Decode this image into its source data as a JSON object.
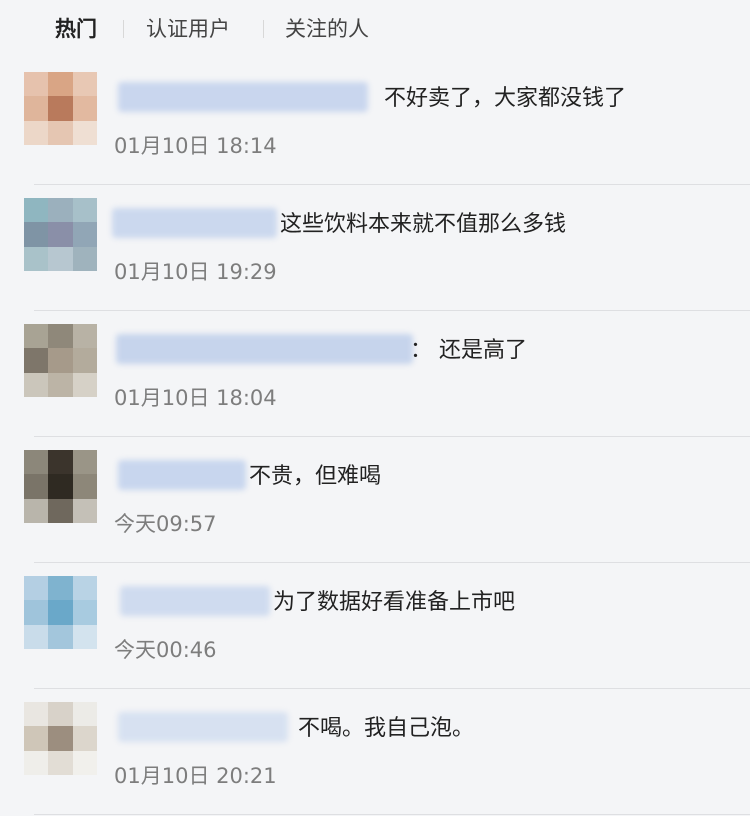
{
  "tabs": [
    {
      "label": "热门",
      "active": true
    },
    {
      "label": "认证用户",
      "active": false
    },
    {
      "label": "关注的人",
      "active": false
    }
  ],
  "comments": [
    {
      "text": "不好卖了，大家都没钱了",
      "time": "01月10日 18:14",
      "avatar_colors": [
        "#e6c2ad",
        "#d9a585",
        "#e8c8b4",
        "#dfb59b",
        "#b97a5c",
        "#e2b9a0",
        "#ecd7c8",
        "#e5c6b2",
        "#efdfd3"
      ],
      "name_color": "#c9d6ee"
    },
    {
      "text": "这些饮料本来就不值那么多钱",
      "time": "01月10日 19:29",
      "avatar_colors": [
        "#8fb6c0",
        "#9bb0bd",
        "#a7c0c9",
        "#7f94a5",
        "#8a8fa8",
        "#91a6b6",
        "#a9c2c9",
        "#b7c7d0",
        "#9fb3bd"
      ],
      "name_color": "#cbd8ee"
    },
    {
      "text": "：  还是高了",
      "time": "01月10日 18:04",
      "avatar_colors": [
        "#a8a394",
        "#8f887a",
        "#b8b2a5",
        "#7e766a",
        "#a69a8a",
        "#b3ab9c",
        "#cbc6bb",
        "#bcb4a6",
        "#d6d1c7"
      ],
      "name_color": "#c6d4ec"
    },
    {
      "text": "不贵，但难喝",
      "time": "今天09:57",
      "avatar_colors": [
        "#8c877a",
        "#3b342c",
        "#9a9587",
        "#7a7468",
        "#2f2a22",
        "#8d8779",
        "#b9b5ab",
        "#6f685d",
        "#c4c0b7"
      ],
      "name_color": "#c8d6ee"
    },
    {
      "text": "为了数据好看准备上市吧",
      "time": "今天00:46",
      "avatar_colors": [
        "#b4cfe3",
        "#7fb3cf",
        "#b9d3e5",
        "#9fc4db",
        "#6aa8c9",
        "#a8cbe0",
        "#c9dcea",
        "#a3c6dc",
        "#d3e3ee"
      ],
      "name_color": "#cfdbef"
    },
    {
      "text": "不喝。我自己泡。",
      "time": "01月10日 20:21",
      "avatar_colors": [
        "#e9e6e1",
        "#d8d2c9",
        "#ecebe7",
        "#cfc6b8",
        "#9c8e7f",
        "#dcd6cc",
        "#efeeea",
        "#e2ddd5",
        "#f1f0ec"
      ],
      "name_color": "#d7e1f1"
    }
  ]
}
